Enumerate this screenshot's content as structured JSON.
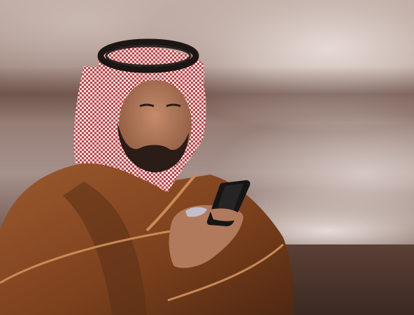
{
  "image": {
    "subject": "",
    "palette": {
      "robe": "#8a4a24",
      "robe_shadow": "#5a2f16",
      "robe_trim": "#c98a55",
      "headdress_white": "#f1e4dc",
      "headdress_red": "#c0404a",
      "agal": "#1c1614",
      "skin": "#b27a5c",
      "beard": "#2a1c17",
      "phone": "#161515",
      "background_light": "#e6dad4",
      "background_dark": "#3e2b24"
    },
    "icons": [
      "person-silhouette",
      "phone-icon"
    ]
  }
}
